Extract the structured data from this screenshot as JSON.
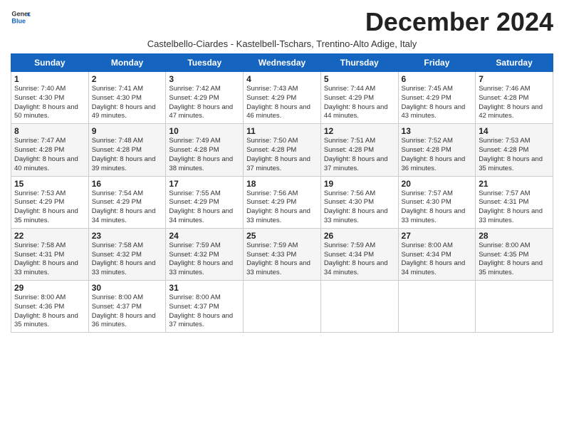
{
  "header": {
    "logo_line1": "General",
    "logo_line2": "Blue",
    "month_title": "December 2024",
    "subtitle": "Castelbello-Ciardes - Kastelbell-Tschars, Trentino-Alto Adige, Italy"
  },
  "weekdays": [
    "Sunday",
    "Monday",
    "Tuesday",
    "Wednesday",
    "Thursday",
    "Friday",
    "Saturday"
  ],
  "weeks": [
    [
      {
        "day": 1,
        "sunrise": "7:40 AM",
        "sunset": "4:30 PM",
        "daylight": "8 hours and 50 minutes."
      },
      {
        "day": 2,
        "sunrise": "7:41 AM",
        "sunset": "4:30 PM",
        "daylight": "8 hours and 49 minutes."
      },
      {
        "day": 3,
        "sunrise": "7:42 AM",
        "sunset": "4:29 PM",
        "daylight": "8 hours and 47 minutes."
      },
      {
        "day": 4,
        "sunrise": "7:43 AM",
        "sunset": "4:29 PM",
        "daylight": "8 hours and 46 minutes."
      },
      {
        "day": 5,
        "sunrise": "7:44 AM",
        "sunset": "4:29 PM",
        "daylight": "8 hours and 44 minutes."
      },
      {
        "day": 6,
        "sunrise": "7:45 AM",
        "sunset": "4:29 PM",
        "daylight": "8 hours and 43 minutes."
      },
      {
        "day": 7,
        "sunrise": "7:46 AM",
        "sunset": "4:28 PM",
        "daylight": "8 hours and 42 minutes."
      }
    ],
    [
      {
        "day": 8,
        "sunrise": "7:47 AM",
        "sunset": "4:28 PM",
        "daylight": "8 hours and 40 minutes."
      },
      {
        "day": 9,
        "sunrise": "7:48 AM",
        "sunset": "4:28 PM",
        "daylight": "8 hours and 39 minutes."
      },
      {
        "day": 10,
        "sunrise": "7:49 AM",
        "sunset": "4:28 PM",
        "daylight": "8 hours and 38 minutes."
      },
      {
        "day": 11,
        "sunrise": "7:50 AM",
        "sunset": "4:28 PM",
        "daylight": "8 hours and 37 minutes."
      },
      {
        "day": 12,
        "sunrise": "7:51 AM",
        "sunset": "4:28 PM",
        "daylight": "8 hours and 37 minutes."
      },
      {
        "day": 13,
        "sunrise": "7:52 AM",
        "sunset": "4:28 PM",
        "daylight": "8 hours and 36 minutes."
      },
      {
        "day": 14,
        "sunrise": "7:53 AM",
        "sunset": "4:28 PM",
        "daylight": "8 hours and 35 minutes."
      }
    ],
    [
      {
        "day": 15,
        "sunrise": "7:53 AM",
        "sunset": "4:29 PM",
        "daylight": "8 hours and 35 minutes."
      },
      {
        "day": 16,
        "sunrise": "7:54 AM",
        "sunset": "4:29 PM",
        "daylight": "8 hours and 34 minutes."
      },
      {
        "day": 17,
        "sunrise": "7:55 AM",
        "sunset": "4:29 PM",
        "daylight": "8 hours and 34 minutes."
      },
      {
        "day": 18,
        "sunrise": "7:56 AM",
        "sunset": "4:29 PM",
        "daylight": "8 hours and 33 minutes."
      },
      {
        "day": 19,
        "sunrise": "7:56 AM",
        "sunset": "4:30 PM",
        "daylight": "8 hours and 33 minutes."
      },
      {
        "day": 20,
        "sunrise": "7:57 AM",
        "sunset": "4:30 PM",
        "daylight": "8 hours and 33 minutes."
      },
      {
        "day": 21,
        "sunrise": "7:57 AM",
        "sunset": "4:31 PM",
        "daylight": "8 hours and 33 minutes."
      }
    ],
    [
      {
        "day": 22,
        "sunrise": "7:58 AM",
        "sunset": "4:31 PM",
        "daylight": "8 hours and 33 minutes."
      },
      {
        "day": 23,
        "sunrise": "7:58 AM",
        "sunset": "4:32 PM",
        "daylight": "8 hours and 33 minutes."
      },
      {
        "day": 24,
        "sunrise": "7:59 AM",
        "sunset": "4:32 PM",
        "daylight": "8 hours and 33 minutes."
      },
      {
        "day": 25,
        "sunrise": "7:59 AM",
        "sunset": "4:33 PM",
        "daylight": "8 hours and 33 minutes."
      },
      {
        "day": 26,
        "sunrise": "7:59 AM",
        "sunset": "4:34 PM",
        "daylight": "8 hours and 34 minutes."
      },
      {
        "day": 27,
        "sunrise": "8:00 AM",
        "sunset": "4:34 PM",
        "daylight": "8 hours and 34 minutes."
      },
      {
        "day": 28,
        "sunrise": "8:00 AM",
        "sunset": "4:35 PM",
        "daylight": "8 hours and 35 minutes."
      }
    ],
    [
      {
        "day": 29,
        "sunrise": "8:00 AM",
        "sunset": "4:36 PM",
        "daylight": "8 hours and 35 minutes."
      },
      {
        "day": 30,
        "sunrise": "8:00 AM",
        "sunset": "4:37 PM",
        "daylight": "8 hours and 36 minutes."
      },
      {
        "day": 31,
        "sunrise": "8:00 AM",
        "sunset": "4:37 PM",
        "daylight": "8 hours and 37 minutes."
      },
      null,
      null,
      null,
      null
    ]
  ]
}
